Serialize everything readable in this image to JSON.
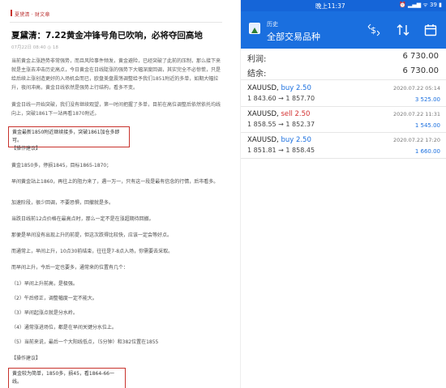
{
  "left": {
    "breadcrumb": "夏黛清 · 财文章",
    "title": "夏黛清：7.22黄金冲锋号角已吹响，必将夺回高地",
    "meta": "07月22日 08:40   ◎ 18",
    "para1": "当前黄金上涨趋势非常强势，而且风险事件频发，黄金避险，已经突破了此前的压制，那么接下来就是主涨去冲击历史高点，今日黄金在日线陡涨的强势下大幅深度回调，其实完全不必惊慌，只是给后续上涨创造更好的入场机会而已，欧盘美盘震荡调整给予我们1851附近的多单，如期大幅拉升，夜间冲高，黄金日线依然是强势上行结构，看多不变。",
    "para2": "黄金日线一开始突破，我们没有继续观望，第一时间把握了多单，目前在高位调整后依然依托均线向上，突破1861下一站再看1870附近。",
    "box1": "黄金最新1850附近继续接多，突破1861加仓多即可。",
    "ops1": "【操作建议】",
    "lines": [
      "黄金1850多，停损1845，目标1865-1870；",
      "早间黄金站上1860，再往上的阻力来了，遇一万一，只有这一段是最有信念的行情，后市看多。",
      "加速阶段，很少回调，不要恐惧，回撤就是多。",
      "当跌日线前12点价格在最高点时，那么一定不是在涨超期待回撤。",
      "那便是早间没有出现上升的前提，但这次跌得比较快，应该一定会等好点。",
      "而通常上，早间上升，10点30前结束，往往是7-8点入场，你需要去采取。",
      "而早间上升，今后一定也要多，通常来的位置有几个：",
      "（1）早间上升前高，是极强。",
      "（2）午后修正，调整幅度一定不能大。",
      "（3）早间起涨点就是分水岭。",
      "（4）通常涨进场位，都是在早间关键分水位上。",
      "（5）当前来说，最后一个大阳线低点，（5分钟）和382位置在1855"
    ],
    "ops2": "【操作建议】",
    "box2": "黄金较为简单，1850多，损45，看1864-66一线。"
  },
  "statusbar": {
    "time": "晚上11:37",
    "icons": "⏰ ▂▄▆ ᯤ 39 ▮"
  },
  "toolbar": {
    "history_label": "历史",
    "all_symbols_label": "全部交易品种"
  },
  "summary": {
    "profit_label": "利润:",
    "profit_value": "6 730.00",
    "balance_label": "结余:",
    "balance_value": "6 730.00"
  },
  "trades": [
    {
      "symbol": "XAUUSD,",
      "side": "buy 2.50",
      "type": "buy",
      "date": "2020.07.22 05:14",
      "prices": "1 843.60 → 1 857.70",
      "profit": "3 525.00"
    },
    {
      "symbol": "XAUUSD,",
      "side": "sell 2.50",
      "type": "sell",
      "date": "2020.07.22 11:31",
      "prices": "1 858.55 → 1 852.37",
      "profit": "1 545.00"
    },
    {
      "symbol": "XAUUSD,",
      "side": "buy 2.50",
      "type": "buy",
      "date": "2020.07.22 17:20",
      "prices": "1 851.81 → 1 858.45",
      "profit": "1 660.00"
    }
  ],
  "colors": {
    "accent": "#1a6fdf",
    "sell": "#d32f2f",
    "highlight_border": "#c8322c"
  }
}
